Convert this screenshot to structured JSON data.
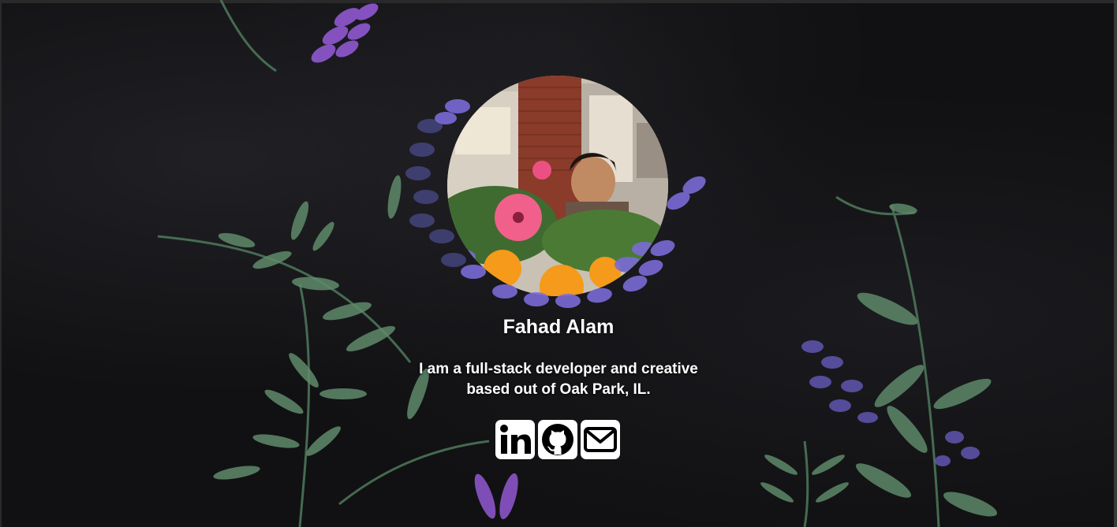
{
  "profile": {
    "name": "Fahad Alam",
    "bio_line1": "I am a full-stack developer and creative",
    "bio_line2": "based out of Oak Park, IL."
  },
  "socials": [
    {
      "icon": "linkedin-icon"
    },
    {
      "icon": "github-icon"
    },
    {
      "icon": "email-icon"
    }
  ],
  "colors": {
    "background": "#111113",
    "text": "#ffffff",
    "icon_tile": "#ffffff",
    "icon_glyph": "#000000",
    "flower_purple": "#7b6bd6",
    "flower_pink": "#f0608a",
    "flower_orange": "#f59a1a",
    "leaf_green": "#5f8a6a"
  }
}
